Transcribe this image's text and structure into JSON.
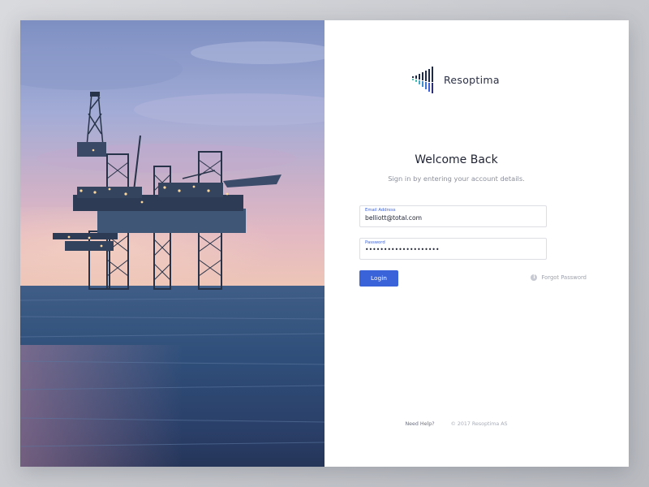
{
  "brand": {
    "name": "Resoptima",
    "logo_icon": "bars-logo-icon",
    "accent_color": "#3b63d9"
  },
  "login": {
    "heading": "Welcome Back",
    "subheading": "Sign in by entering your account details.",
    "email_label": "Email Address",
    "email_value": "belliott@total.com",
    "password_label": "Password",
    "password_value": "••••••••••••••••••••",
    "login_button": "Login",
    "forgot_icon": "info-icon",
    "forgot_label": "Forgot Password"
  },
  "footer": {
    "help_link": "Need Help?",
    "copyright": "© 2017 Resoptima AS"
  },
  "hero": {
    "image": "offshore-oil-rig-at-dusk"
  }
}
